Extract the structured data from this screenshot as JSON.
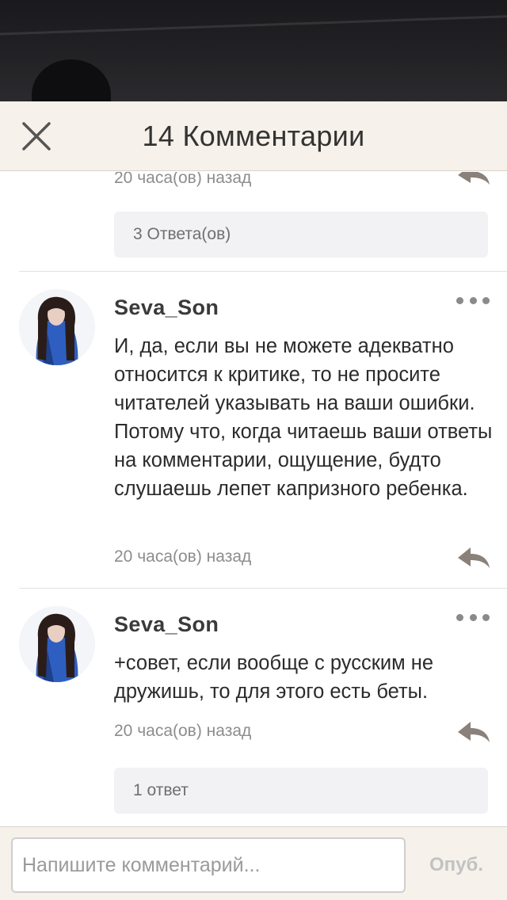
{
  "header": {
    "title": "14 Комментарии",
    "close_icon": "close-icon"
  },
  "thread": {
    "previous_meta": "20 часа(ов) назад",
    "previous_replies": "3 Ответа(ов)"
  },
  "comments": [
    {
      "author": "Seva_Son",
      "text": "И, да, если вы не можете адекватно относится к критике, то не просите читателей указывать на ваши ошибки. Потому что, когда читаешь ваши ответы на комментарии, ощущение, будто слушаешь лепет капризного ребенка.",
      "meta": "20 часа(ов) назад"
    },
    {
      "author": "Seva_Son",
      "text": "+совет, если вообще с русским не дружишь, то для этого есть беты.",
      "meta": "20 часа(ов) назад",
      "replies": "1 ответ"
    }
  ],
  "composer": {
    "placeholder": "Напишите комментарий...",
    "publish_label": "Опуб."
  },
  "icons": {
    "reply": "reply-arrow-icon",
    "more": "more-dots-icon"
  },
  "colors": {
    "header_bg": "#f6f1ea",
    "reply_icon": "#8a817a",
    "muted_text": "#8d8d8d",
    "replies_box_bg": "#f2f2f4"
  }
}
